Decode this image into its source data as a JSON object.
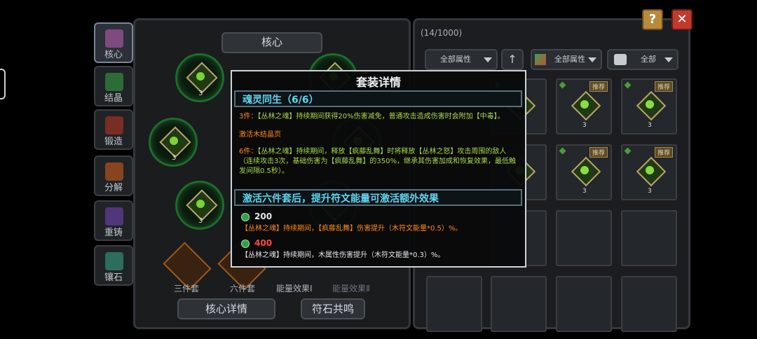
{
  "sidebar": {
    "tabs": [
      {
        "label": "核心",
        "icon": "core-tab-icon"
      },
      {
        "label": "结晶",
        "icon": "crystal-tab-icon"
      },
      {
        "label": "锻造",
        "icon": "forge-tab-icon"
      },
      {
        "label": "分解",
        "icon": "decompose-tab-icon"
      },
      {
        "label": "重铸",
        "icon": "recast-tab-icon"
      },
      {
        "label": "镶石",
        "icon": "inlay-tab-icon"
      }
    ]
  },
  "core_panel": {
    "title": "核心",
    "rune_level": "3",
    "set_labels": [
      "三件套",
      "六件套",
      "能量效果Ⅰ",
      "能量效果Ⅱ"
    ],
    "buttons": {
      "core_detail": "核心详情",
      "rune_resonance": "符石共鸣"
    }
  },
  "inventory": {
    "count": "(14/1000)",
    "filters": {
      "attribute": "全部属性",
      "attribute2": "全部属性",
      "type": "全部"
    },
    "badge": "推荐",
    "item_level": "3"
  },
  "modal": {
    "title": "套装详情",
    "set_header": "魂灵同生（6/6）",
    "three_piece_prefix": "3件：",
    "three_piece_text": "【丛林之魂】持续期间获得20%伤害减免，普通攻击造成伤害时会附加【中毒】。",
    "activate_note": "激活木结晶页",
    "six_piece_prefix": "6件：",
    "six_piece_text": "【丛林之魂】持续期间，释放【疯藤乱舞】时将释放【丛林之怒】攻击周围的敌人（连续攻击3次，基础伤害为【疯藤乱舞】的350%，继承其伤害加成和恢复效果，最低触发间隔0.5秒）。",
    "energy_header": "激活六件套后，提升符文能量可激活额外效果",
    "energy1_value": "200",
    "energy1_text": "【丛林之魂】持续期间，【疯藤乱舞】伤害提升（木符文能量*0.5）%。",
    "energy2_value": "400",
    "energy2_text": "【丛林之魂】持续期间，木属性伤害提升（木符文能量*0.3）%。"
  },
  "colors": {
    "accent_cyan": "#5fd6ee",
    "green_text": "#a8d94b",
    "orange_text": "#ff8a1c",
    "red_text": "#ff4a3d",
    "close_red": "#c23a2e",
    "help_gold": "#b88a3c"
  }
}
